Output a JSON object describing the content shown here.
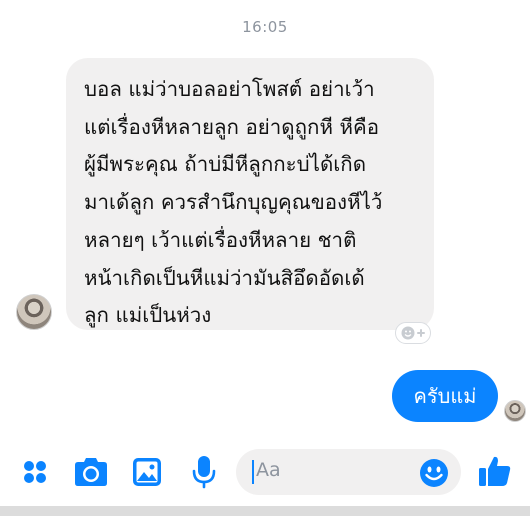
{
  "conversation": {
    "timestamp": "16:05",
    "incoming": {
      "lines": [
        "บอล แม่ว่าบอลอย่าโพสต์ อย่าเว้า",
        "แต่เรื่องหีหลายลูก อย่าดูถูกหี หีคือ",
        "ผู้มีพระคุณ ถ้าบ่มีหีลูกกะบ่ได้เกิด",
        "มาเด้ลูก ควรสำนึกบุญคุณของหีไว้",
        "หลายๆ เว้าแต่เรื่องหีหลาย ชาติ",
        "หน้าเกิดเป็นหีแม่ว่ามันสิอึดอัดเด้",
        "ลูก แม่เป็นห่วง"
      ]
    },
    "outgoing": {
      "text": "ครับแม่"
    }
  },
  "composer": {
    "placeholder": "Aa",
    "icons": [
      "apps-icon",
      "camera-icon",
      "image-icon",
      "microphone-icon",
      "emoji-icon",
      "like-icon"
    ]
  },
  "colors": {
    "accent": "#0b84ff",
    "bubble_gray": "#f1f0f0",
    "muted": "#8d949e"
  }
}
